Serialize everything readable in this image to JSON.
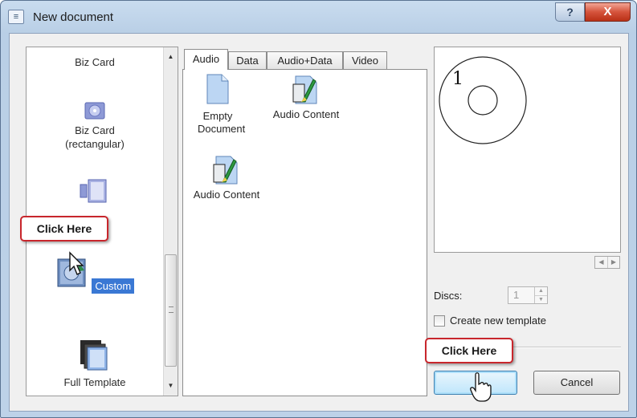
{
  "window": {
    "title": "New document",
    "help_label": "?",
    "close_label": "X"
  },
  "templates": {
    "items": [
      {
        "label": "Biz Card"
      },
      {
        "label": "Biz Card (rectangular)"
      },
      {
        "label": "Custom",
        "selected": true
      },
      {
        "label": "Full Template"
      }
    ]
  },
  "tabs": [
    {
      "label": "Audio",
      "active": true
    },
    {
      "label": "Data"
    },
    {
      "label": "Audio+Data"
    },
    {
      "label": "Video"
    }
  ],
  "documents": [
    {
      "label": "Empty Document",
      "icon": "blank-document-icon"
    },
    {
      "label": "Audio Content",
      "icon": "audio-content-icon"
    },
    {
      "label": "Audio Content",
      "icon": "audio-content-icon"
    }
  ],
  "preview": {
    "disc_number": "1"
  },
  "options": {
    "discs_label": "Discs:",
    "discs_value": "1",
    "create_template_label": "Create new template",
    "create_template_checked": false
  },
  "buttons": {
    "ok_label": "",
    "cancel_label": "Cancel"
  },
  "callouts": {
    "left": "Click Here",
    "right": "Click Here",
    "border_color": "#c8262c"
  },
  "colors": {
    "selection": "#3a78d4",
    "title_gradient": "#c9dcef",
    "close_button": "#d5533c"
  }
}
